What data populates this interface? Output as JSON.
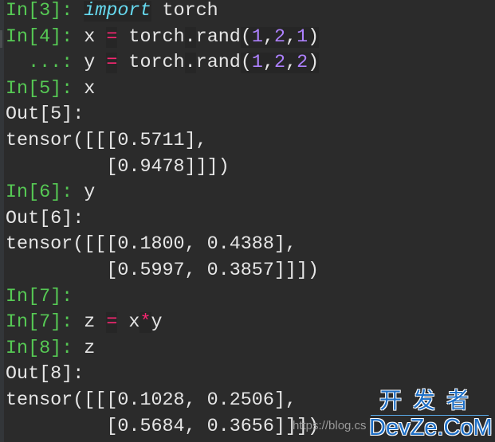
{
  "colors": {
    "background": "#2b2b2b",
    "prompt_in": "#56c954",
    "keyword": "#66d9ef",
    "operator": "#f92672",
    "number": "#ae81ff",
    "text": "#e6e6e6",
    "watermark_blue": "#1e6fc6"
  },
  "console": {
    "lines": [
      {
        "prompt": "In[3]: ",
        "kw": "import",
        "rest": " torch"
      },
      {
        "prompt": "In[4]: ",
        "a": "x ",
        "op": "=",
        "b": " torch",
        "dot": ".",
        "c": "rand",
        "open": "(",
        "n1": "1",
        "s1": ",",
        "n2": "2",
        "s2": ",",
        "n3": "1",
        "close": ")"
      },
      {
        "prompt": "  ...: ",
        "a": "y ",
        "op": "=",
        "b": " torch",
        "dot": ".",
        "c": "rand",
        "open": "(",
        "n1": "1",
        "s1": ",",
        "n2": "2",
        "s2": ",",
        "n3": "2",
        "close": ")"
      },
      {
        "prompt": "In[5]: ",
        "code": "x"
      },
      {
        "prompt": "Out[5]:"
      },
      {
        "text": "tensor([[[0.5711],"
      },
      {
        "text": "         [0.9478]]])"
      },
      {
        "prompt": "In[6]: ",
        "code": "y"
      },
      {
        "prompt": "Out[6]:"
      },
      {
        "text": "tensor([[[0.1800, 0.4388],"
      },
      {
        "text": "         [0.5997, 0.3857]]])"
      },
      {
        "prompt": "In[7]:"
      },
      {
        "prompt": "In[7]: ",
        "a": "z ",
        "op": "=",
        "b": " x",
        "star": "*",
        "c": "y"
      },
      {
        "prompt": "In[8]: ",
        "code": "z"
      },
      {
        "prompt": "Out[8]:"
      },
      {
        "text": "tensor([[[0.1028, 0.2506],"
      },
      {
        "text": "         [0.5684, 0.3656]]])"
      }
    ]
  },
  "watermark": {
    "url": "https://blog.cs",
    "cn": "开发者",
    "en": "DevZe.CoM"
  }
}
